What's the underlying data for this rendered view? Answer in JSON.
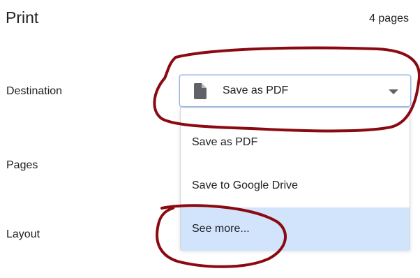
{
  "header": {
    "title": "Print",
    "page_count": "4 pages"
  },
  "rows": {
    "destination_label": "Destination",
    "pages_label": "Pages",
    "layout_label": "Layout"
  },
  "destination_select": {
    "selected_value": "Save as PDF",
    "icon": "document-icon",
    "caret": "caret-down-icon"
  },
  "destination_menu": {
    "options": [
      {
        "label": "Save as PDF"
      },
      {
        "label": "Save to Google Drive"
      },
      {
        "label": "See more...",
        "highlighted": true
      }
    ]
  },
  "colors": {
    "text": "#202124",
    "select_border": "#9ab7e3",
    "highlight": "#d2e3fc",
    "annotation": "#8b0a12"
  }
}
